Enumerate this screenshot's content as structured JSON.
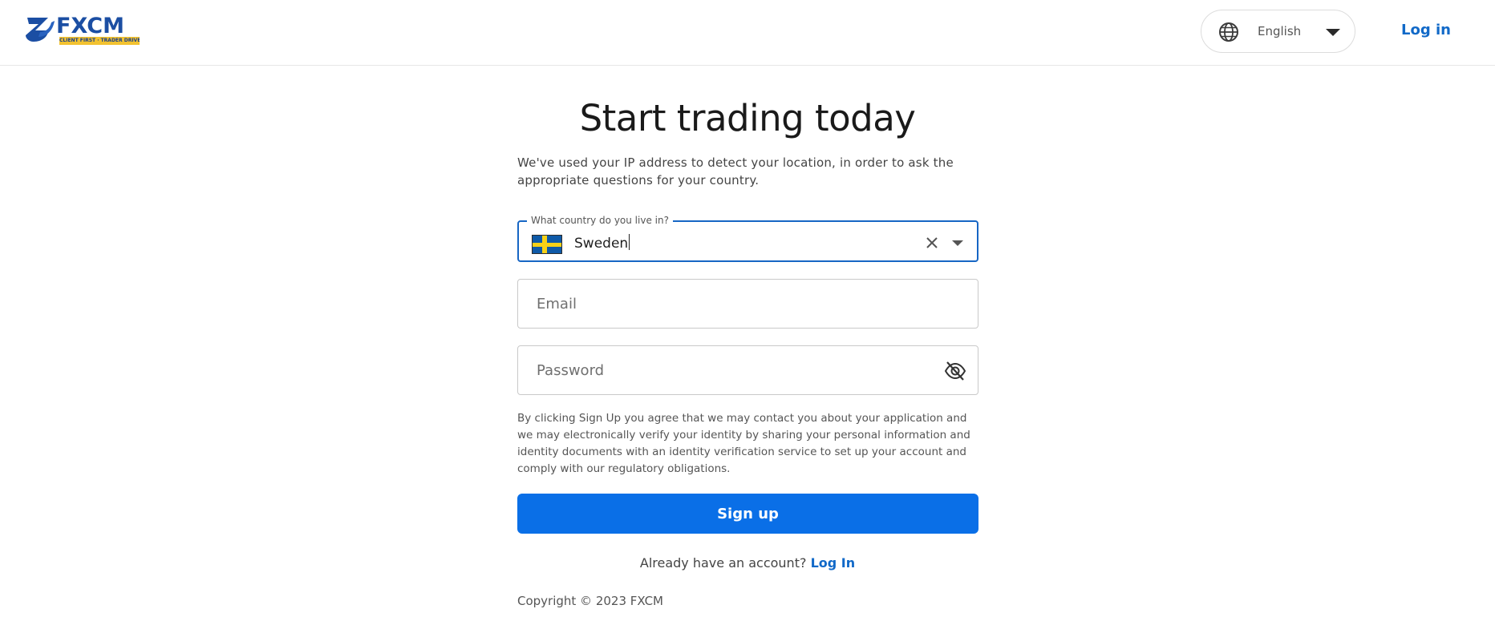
{
  "header": {
    "logo_text": "FXCM",
    "logo_tagline": "CLIENT FIRST · TRADER DRIVEN",
    "language": {
      "selected": "English",
      "icon": "globe-icon"
    },
    "login_label": "Log in"
  },
  "main": {
    "title": "Start trading today",
    "intro": "We've used your IP address to detect your location, in order to ask the appropriate questions for your country.",
    "country_field": {
      "label": "What country do you live in?",
      "value": "Sweden",
      "flag_icon": "sweden-flag-icon"
    },
    "email_field": {
      "placeholder": "Email",
      "value": ""
    },
    "password_field": {
      "placeholder": "Password",
      "value": "",
      "toggle_icon": "eye-off-icon"
    },
    "consent": "By clicking Sign Up you agree that we may contact you about your application and we may electronically verify your identity by sharing your personal information and identity documents with an identity verification service to set up your account and comply with our regulatory obligations.",
    "signup_label": "Sign up",
    "already_text": "Already have an account?",
    "login_link": "Log In",
    "copyright": "Copyright © 2023 FXCM"
  },
  "colors": {
    "accent_blue": "#0a6fe7",
    "link_blue": "#1169c8",
    "focus_border": "#1766c4",
    "brand_navy": "#1b4ea3",
    "brand_yellow": "#f2c230"
  }
}
